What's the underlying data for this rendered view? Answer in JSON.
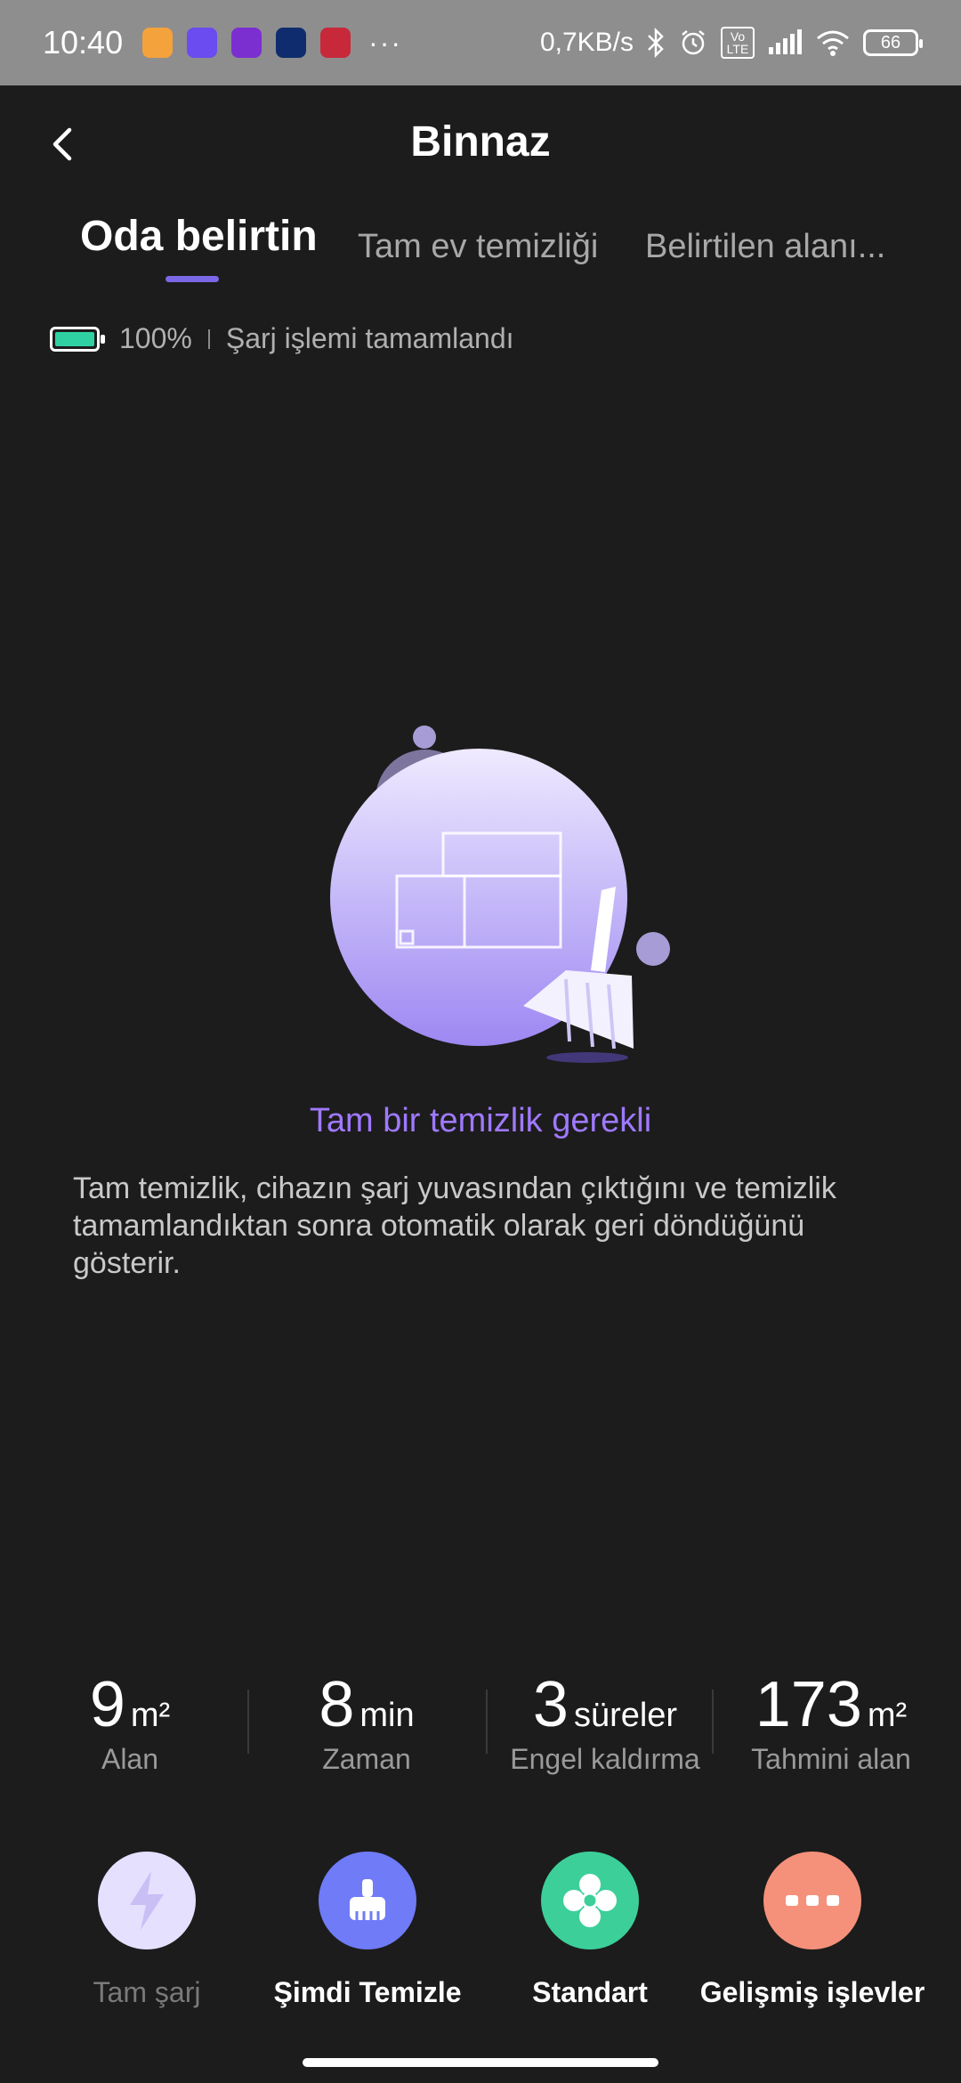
{
  "status_bar": {
    "time": "10:40",
    "speed": "0,7KB/s",
    "battery": "66",
    "dots": "···",
    "volte": "Vo LTE",
    "app_icons": [
      "notes-app",
      "browser-app",
      "monitor-app",
      "mynet-app",
      "shop-app"
    ]
  },
  "header": {
    "title": "Binnaz"
  },
  "tabs": [
    {
      "label": "Oda belirtin",
      "active": true
    },
    {
      "label": "Tam ev temizliği",
      "active": false
    },
    {
      "label": "Belirtilen alanı...",
      "active": false
    }
  ],
  "charge": {
    "percent": "100%",
    "status": "Şarj işlemi tamamlandı",
    "level": 1.0
  },
  "message": {
    "title": "Tam bir temizlik gerekli",
    "body": "Tam temizlik, cihazın şarj yuvasından çıktığını ve temizlik tamamlandıktan sonra otomatik olarak geri döndüğünü gösterir."
  },
  "stats": [
    {
      "value": "9",
      "unit": "m²",
      "label": "Alan"
    },
    {
      "value": "8",
      "unit": "min",
      "label": "Zaman"
    },
    {
      "value": "3",
      "unit": "süreler",
      "label": "Engel kaldırma"
    },
    {
      "value": "173",
      "unit": "m²",
      "label": "Tahmini alan"
    }
  ],
  "actions": [
    {
      "label": "Tam şarj",
      "icon": "lightning-icon",
      "color": "#e6e0ff",
      "enabled": false
    },
    {
      "label": "Şimdi Temizle",
      "icon": "broom-icon",
      "color": "#6f7bf7",
      "enabled": true
    },
    {
      "label": "Standart",
      "icon": "fan-icon",
      "color": "#3ccf9a",
      "enabled": true
    },
    {
      "label": "Gelişmiş işlevler",
      "icon": "more-icon",
      "color": "#f5917a",
      "enabled": true
    }
  ],
  "colors": {
    "accent": "#7a68e6",
    "headline": "#9f79ff",
    "battery_fill": "#2fd1a3",
    "background": "#1c1c1c"
  }
}
